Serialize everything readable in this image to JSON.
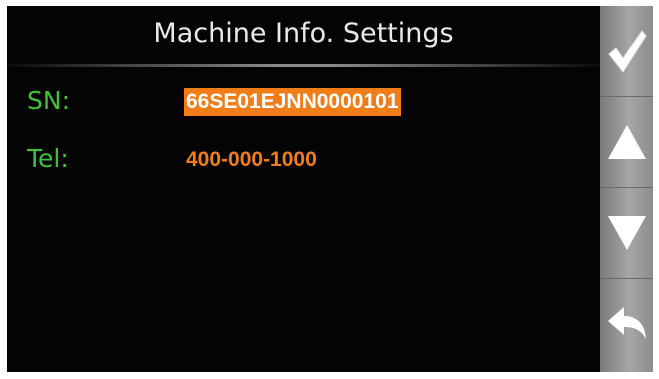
{
  "header": {
    "title": "Machine Info. Settings"
  },
  "fields": [
    {
      "label": "SN:",
      "value": "66SE01EJNN0000101",
      "selected": true
    },
    {
      "label": "Tel:",
      "value": "400-000-1000",
      "selected": false
    }
  ],
  "side_buttons": [
    {
      "icon": "checkmark-icon"
    },
    {
      "icon": "up-arrow-icon"
    },
    {
      "icon": "down-arrow-icon"
    },
    {
      "icon": "back-arrow-icon"
    }
  ],
  "colors": {
    "background": "#040404",
    "title_text": "#e9e9e9",
    "label_text": "#3cc43a",
    "value_text": "#f07d17",
    "selection_bg": "#f07d17",
    "side_panel": "#8e8e8e"
  }
}
